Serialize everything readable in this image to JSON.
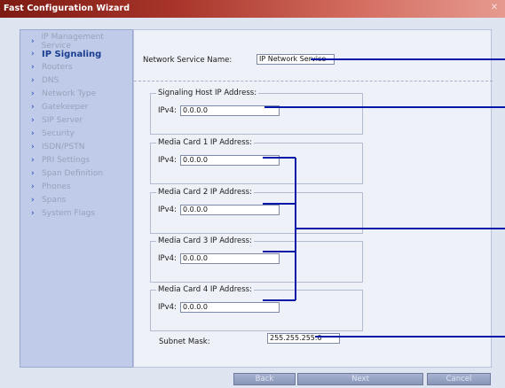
{
  "window": {
    "title": "Fast Configuration Wizard",
    "close_icon": "close-icon"
  },
  "nav": {
    "items": [
      {
        "label": "IP Management Service",
        "active": false
      },
      {
        "label": "IP Signaling",
        "active": true
      },
      {
        "label": "Routers",
        "active": false
      },
      {
        "label": "DNS",
        "active": false
      },
      {
        "label": "Network Type",
        "active": false
      },
      {
        "label": "Gatekeeper",
        "active": false
      },
      {
        "label": "SIP Server",
        "active": false
      },
      {
        "label": "Security",
        "active": false
      },
      {
        "label": "ISDN/PSTN",
        "active": false
      },
      {
        "label": "PRI Settings",
        "active": false
      },
      {
        "label": "Span Definition",
        "active": false
      },
      {
        "label": "Phones",
        "active": false
      },
      {
        "label": "Spans",
        "active": false
      },
      {
        "label": "System Flags",
        "active": false
      }
    ]
  },
  "form": {
    "network_service_name_label": "Network Service Name:",
    "network_service_name_value": "IP Network Service",
    "ipv4_label": "IPv4:",
    "groups": [
      {
        "legend": "Signaling Host IP Address:",
        "value": "0.0.0.0"
      },
      {
        "legend": "Media Card 1 IP Address:",
        "value": "0.0.0.0"
      },
      {
        "legend": "Media Card 2 IP Address:",
        "value": "0.0.0.0"
      },
      {
        "legend": "Media Card 3 IP Address:",
        "value": "0.0.0.0"
      },
      {
        "legend": "Media Card 4 IP Address:",
        "value": "0.0.0.0"
      }
    ],
    "subnet_mask_label": "Subnet Mask:",
    "subnet_mask_value": "255.255.255.0"
  },
  "buttons": {
    "back": "Back",
    "next": "Next",
    "cancel": "Cancel"
  },
  "colors": {
    "callout_line": "#0018a8",
    "title_bar": "#8f2419",
    "nav_active": "#1a3d8f"
  }
}
